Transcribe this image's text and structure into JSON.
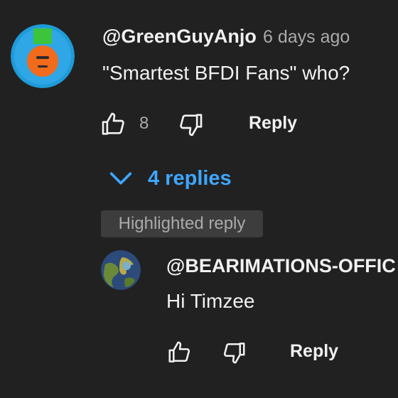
{
  "comment": {
    "author": "@GreenGuyAnjo",
    "timestamp": "6 days ago",
    "text": "\"Smartest BFDI Fans\" who?",
    "like_count": "8",
    "reply_label": "Reply",
    "avatar_icon": "green-character-avatar"
  },
  "replies_toggle": {
    "label": "4 replies",
    "color": "#3ea6ff"
  },
  "highlighted_reply": {
    "badge": "Highlighted reply",
    "author": "@BEARIMATIONS-OFFIC",
    "text": "Hi Timzee",
    "reply_label": "Reply",
    "avatar_icon": "globe-avatar"
  },
  "colors": {
    "background": "#212121",
    "text_primary": "#f1f1f1",
    "text_secondary": "#aaaaaa",
    "badge_bg": "#3d3d3d",
    "link_blue": "#3ea6ff"
  }
}
